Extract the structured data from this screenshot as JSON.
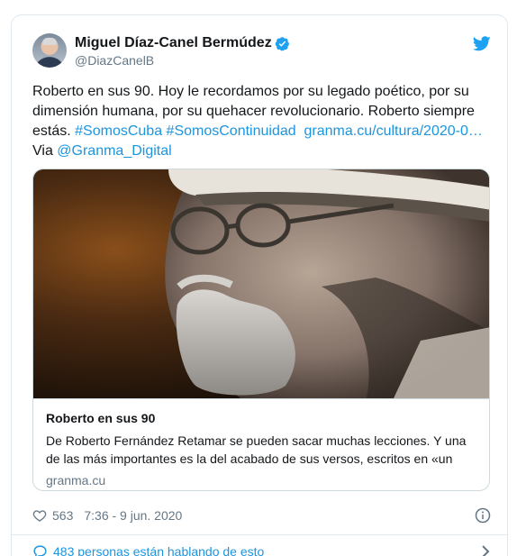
{
  "author": {
    "display_name": "Miguel Díaz-Canel Bermúdez",
    "handle": "@DiazCanelB",
    "verified": true
  },
  "tweet": {
    "lines": [
      "Roberto en sus 90. Hoy le recordamos por su legado poético, por su",
      "dimensión humana, por su quehacer revolucionario. Roberto siempre"
    ],
    "line3_text": "estás. ",
    "hashtag_1": "#SomosCuba",
    "hashtag_2": "#SomosContinuidad",
    "url": "granma.cu/cultura/2020-0…",
    "via_text": "Via ",
    "mention": "@Granma_Digital"
  },
  "card": {
    "title": "Roberto en sus 90",
    "description_lines": [
      "De Roberto Fernández Retamar se pueden sacar muchas lecciones. Y una",
      "de las más importantes es la del acabado de sus versos, escritos en «un"
    ],
    "domain": "granma.cu"
  },
  "meta": {
    "likes": "563",
    "timestamp": "7:36 - 9 jun. 2020"
  },
  "conversation": {
    "label": "483 personas están hablando de esto"
  },
  "colors": {
    "link": "#1b95e0",
    "text": "#14171a",
    "secondary": "#657786",
    "border": "#e1e8ed"
  },
  "icons": [
    "verified-badge-icon",
    "twitter-bird-icon",
    "heart-icon",
    "info-icon",
    "chat-bubble-icon",
    "chevron-right-icon"
  ]
}
